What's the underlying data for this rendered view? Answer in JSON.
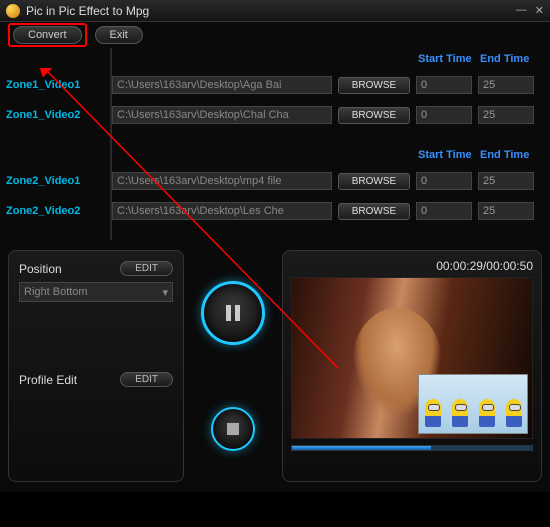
{
  "window": {
    "title": "Pic in Pic Effect to Mpg"
  },
  "toolbar": {
    "convert_label": "Convert",
    "exit_label": "Exit"
  },
  "headers": {
    "start_time": "Start Time",
    "end_time": "End Time"
  },
  "zone1": {
    "rows": [
      {
        "label": "Zone1_Video1",
        "path": "C:\\Users\\163arv\\Desktop\\Aga Bai",
        "browse": "BROWSE",
        "start": "0",
        "end": "25"
      },
      {
        "label": "Zone1_Video2",
        "path": "C:\\Users\\163arv\\Desktop\\Chal Cha",
        "browse": "BROWSE",
        "start": "0",
        "end": "25"
      }
    ]
  },
  "zone2": {
    "rows": [
      {
        "label": "Zone2_Video1",
        "path": "C:\\Users\\163arv\\Desktop\\mp4 file",
        "browse": "BROWSE",
        "start": "0",
        "end": "25"
      },
      {
        "label": "Zone2_Video2",
        "path": "C:\\Users\\163arv\\Desktop\\Les Che",
        "browse": "BROWSE",
        "start": "0",
        "end": "25"
      }
    ]
  },
  "position": {
    "title": "Position",
    "edit_label": "EDIT",
    "value": "Right Bottom"
  },
  "profile": {
    "title": "Profile Edit",
    "edit_label": "EDIT"
  },
  "preview": {
    "time": "00:00:29/00:00:50"
  }
}
